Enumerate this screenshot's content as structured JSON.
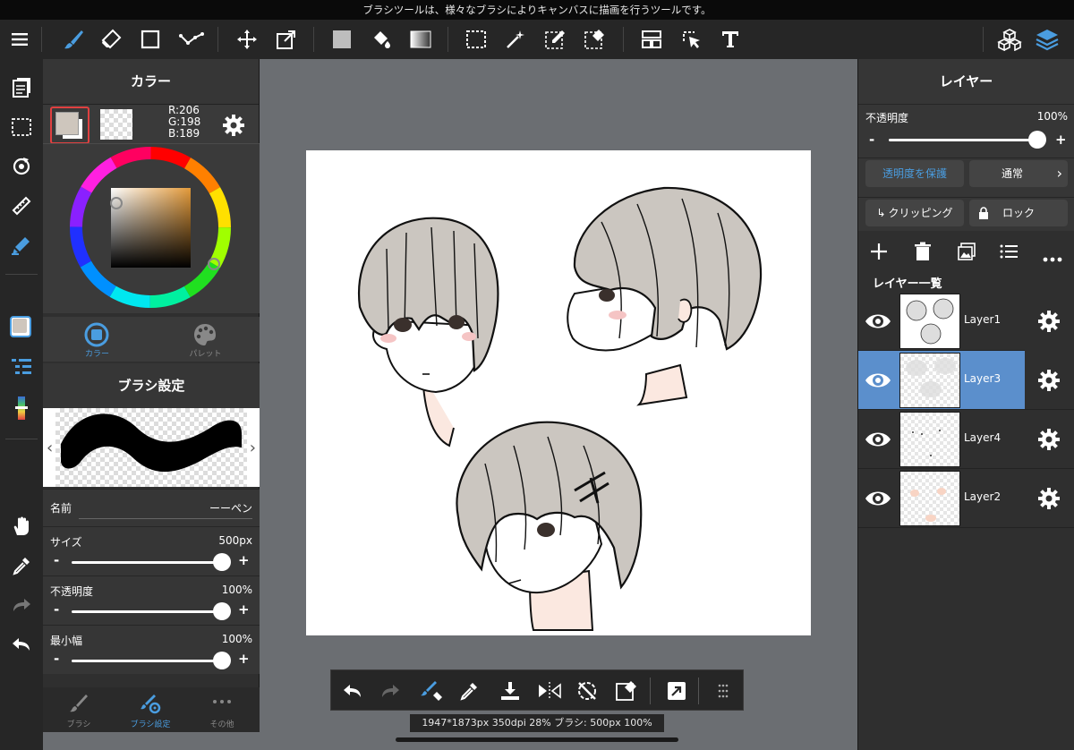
{
  "top_message": "ブラシツールは、様々なブラシによりキャンバスに描画を行うツールです。",
  "toolbar": {
    "tools": [
      "menu-icon",
      "brush-icon",
      "eraser-icon",
      "rectangle-icon",
      "connector-icon",
      "move-icon",
      "transform-icon",
      "fill-color-icon",
      "bucket-icon",
      "gradient-icon",
      "select-rect-icon",
      "magic-wand-icon",
      "select-pen-icon",
      "select-eraser-icon",
      "frame-icon",
      "operation-icon",
      "text-icon",
      "material-icon",
      "layers-icon"
    ],
    "accent": "#4a9de0"
  },
  "color_panel": {
    "title": "カラー",
    "main_color": "#cec6bd",
    "rgb": {
      "r": "R:206",
      "g": "G:198",
      "b": "B:189"
    },
    "tabs": [
      {
        "label": "カラー",
        "active": true
      },
      {
        "label": "パレット",
        "active": false
      }
    ]
  },
  "brush_panel": {
    "title": "ブラシ設定",
    "name_label": "名前",
    "name_value": "ーーペン",
    "props": [
      {
        "label": "サイズ",
        "value": "500px",
        "level": 1.0
      },
      {
        "label": "不透明度",
        "value": "100%",
        "level": 1.0
      },
      {
        "label": "最小幅",
        "value": "100%",
        "level": 1.0
      }
    ],
    "minus": "-",
    "plus": "+"
  },
  "left_bottom_tabs": [
    {
      "label": "ブラシ",
      "active": false
    },
    {
      "label": "ブラシ設定",
      "active": true
    },
    {
      "label": "その他",
      "active": false
    }
  ],
  "status": "1947*1873px 350dpi 28% ブラシ: 500px 100%",
  "layers_panel": {
    "title": "レイヤー",
    "opacity_label": "不透明度",
    "opacity_value": "100%",
    "opacity_level": 1.0,
    "protect_label": "透明度を保護",
    "blend_label": "通常",
    "clipping_label": "クリッピング",
    "lock_label": "ロック",
    "list_label": "レイヤー一覧",
    "layers": [
      {
        "name": "Layer1",
        "selected": false
      },
      {
        "name": "Layer3",
        "selected": true
      },
      {
        "name": "Layer4",
        "selected": false
      },
      {
        "name": "Layer2",
        "selected": false
      }
    ]
  },
  "hair_color": "#cbc6c0",
  "skin_color": "#fbe8e0"
}
